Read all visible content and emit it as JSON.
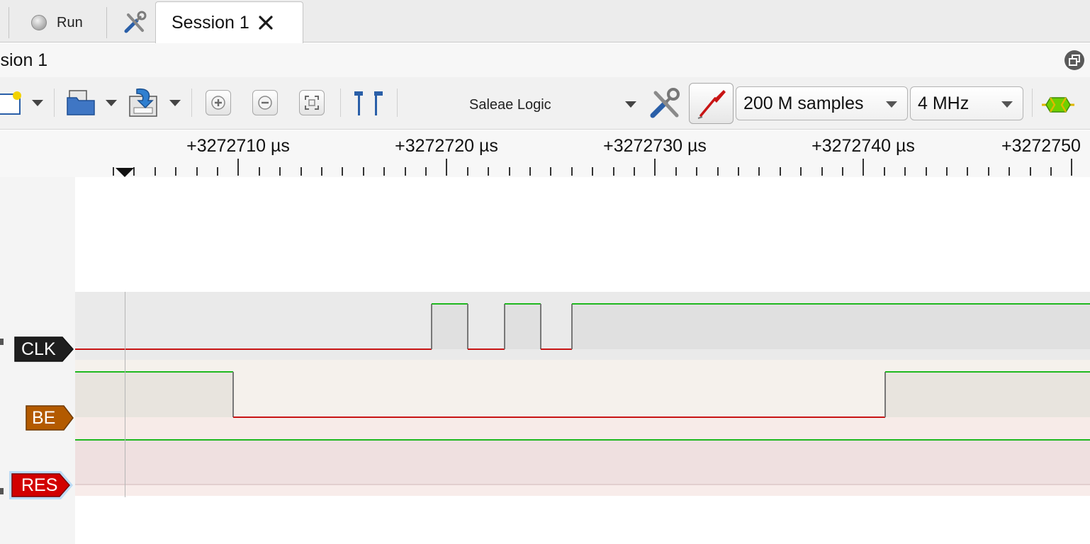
{
  "tabs": {
    "run_label": "Run",
    "session_label": "Session 1"
  },
  "header": {
    "session_title": "ssion 1"
  },
  "toolbar": {
    "device": "Saleae Logic",
    "samples": "200 M samples",
    "rate": "4 MHz"
  },
  "ruler": {
    "labels": [
      "+3272710 µs",
      "+3272720 µs",
      "+3272730 µs",
      "+3272740 µs",
      "+3272750"
    ]
  },
  "channels": [
    {
      "name": "CLK",
      "color": "#1e1e1e"
    },
    {
      "name": "BE",
      "color": "#b35a00"
    },
    {
      "name": "RES",
      "color": "#d20000"
    }
  ],
  "colors": {
    "high": "#1fb81f",
    "low": "#c81414",
    "accent_yellow": "#f2d200",
    "icon_blue": "#2a5fa8"
  },
  "icons": [
    "new-session-icon",
    "open-file-icon",
    "save-file-icon",
    "zoom-in-icon",
    "zoom-out-icon",
    "zoom-fit-icon",
    "markers-icon",
    "device-settings-icon",
    "probe-icon",
    "analyzer-icon",
    "restore-icon",
    "close-icon",
    "tools-icon"
  ]
}
